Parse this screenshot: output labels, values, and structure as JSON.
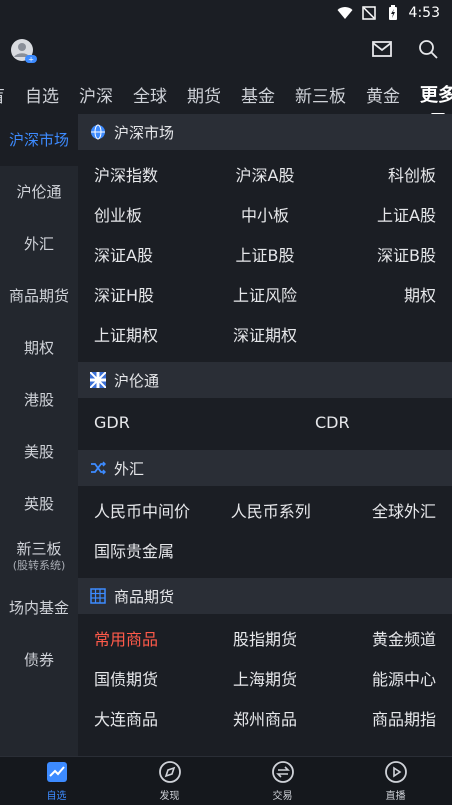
{
  "status_bar": {
    "time": "4:53"
  },
  "top_tabs": [
    {
      "label": "自选",
      "active": false
    },
    {
      "label": "沪深",
      "active": false
    },
    {
      "label": "全球",
      "active": false
    },
    {
      "label": "期货",
      "active": false
    },
    {
      "label": "基金",
      "active": false
    },
    {
      "label": "新三板",
      "active": false
    },
    {
      "label": "黄金",
      "active": false
    },
    {
      "label": "更多",
      "active": true
    }
  ],
  "top_tabs_partial": "盲",
  "sidebar": {
    "items": [
      {
        "label": "沪深市场",
        "active": true
      },
      {
        "label": "沪伦通"
      },
      {
        "label": "外汇"
      },
      {
        "label": "商品期货"
      },
      {
        "label": "期权"
      },
      {
        "label": "港股"
      },
      {
        "label": "美股"
      },
      {
        "label": "英股"
      },
      {
        "label": "新三板",
        "sub": "(股转系统)"
      },
      {
        "label": "场内基金"
      },
      {
        "label": "债券"
      }
    ]
  },
  "sections": {
    "hushen": {
      "title": "沪深市场",
      "rows": [
        [
          "沪深指数",
          "沪深A股",
          "科创板"
        ],
        [
          "创业板",
          "中小板",
          "上证A股"
        ],
        [
          "深证A股",
          "上证B股",
          "深证B股"
        ],
        [
          "深证H股",
          "上证风险",
          "期权"
        ],
        [
          "上证期权",
          "深证期权"
        ]
      ]
    },
    "hulun": {
      "title": "沪伦通",
      "rows": [
        [
          "GDR",
          "CDR"
        ]
      ]
    },
    "fx": {
      "title": "外汇",
      "rows": [
        [
          "人民币中间价",
          "人民币系列",
          "全球外汇"
        ],
        [
          "国际贵金属"
        ]
      ]
    },
    "commodity": {
      "title": "商品期货",
      "rows": [
        [
          "常用商品",
          "股指期货",
          "黄金频道"
        ],
        [
          "国债期货",
          "上海期货",
          "能源中心"
        ],
        [
          "大连商品",
          "郑州商品",
          "商品期指"
        ]
      ]
    }
  },
  "bottom_nav": [
    {
      "label": "自选",
      "icon": "chart-icon",
      "active": true
    },
    {
      "label": "发现",
      "icon": "compass-icon"
    },
    {
      "label": "交易",
      "icon": "exchange-icon"
    },
    {
      "label": "直播",
      "icon": "play-icon"
    }
  ],
  "colors": {
    "accent": "#3d8bff",
    "highlight": "#ff5a4a",
    "background": "#1b1e24"
  }
}
